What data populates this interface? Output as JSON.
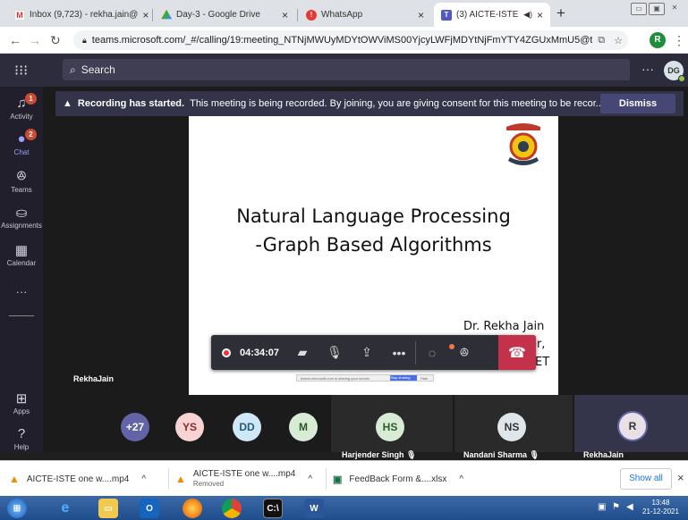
{
  "browser": {
    "tabs": [
      {
        "title": "Inbox (9,723) - rekha.jain@",
        "close": "×"
      },
      {
        "title": "Day-3 - Google Drive",
        "close": "×"
      },
      {
        "title": "WhatsApp",
        "close": "×"
      },
      {
        "title": "(3) AICTE-ISTE one wee",
        "close": "×"
      }
    ],
    "new_tab": "+",
    "url": "teams.microsoft.com/_#/calling/19:meeting_NTNjMWUyMDYtOWViMS00YjcyLWFjMDYtNjFmYTY4ZGUxMmU5@threa...",
    "profile_initial": "R"
  },
  "teams": {
    "search_placeholder": "Search",
    "user_initials": "DG",
    "more": "···",
    "rail": [
      {
        "label": "Activity",
        "badge": "1"
      },
      {
        "label": "Chat",
        "badge": "2"
      },
      {
        "label": "Teams"
      },
      {
        "label": "Assignments"
      },
      {
        "label": "Calendar"
      },
      {
        "label": "···"
      },
      {
        "label": "Apps"
      },
      {
        "label": "Help"
      }
    ]
  },
  "banner": {
    "bold": "Recording has started.",
    "text": "This meeting is being recorded. By joining, you are giving consent for this meeting to be recor...",
    "dismiss": "Dismiss"
  },
  "slide": {
    "title_line1": "Natural Language Processing",
    "title_line2": "-Graph Based Algorithms",
    "author": "Dr. Rekha Jain",
    "author_line2_partial": "or,",
    "author_line3_partial": "ET",
    "share_text": "teams.microsoft.com is sharing your screen",
    "share_stop": "Stop sharing",
    "share_hide": "Hide"
  },
  "call": {
    "timer": "04:34:07",
    "presenter_label": "RekhaJain"
  },
  "participants": {
    "overflow": "+27",
    "small": [
      {
        "initials": "YS",
        "bg": "#f7d3d3",
        "fg": "#8c2a2a"
      },
      {
        "initials": "DD",
        "bg": "#cfe8f7",
        "fg": "#245a7a"
      },
      {
        "initials": "M",
        "bg": "#d7ebd5",
        "fg": "#2b5b28"
      }
    ],
    "tiles": [
      {
        "initials": "HS",
        "name": "Harjender Singh"
      },
      {
        "initials": "NS",
        "name": "Nandani Sharma"
      },
      {
        "initials": "R",
        "name": "RekhaJain"
      }
    ]
  },
  "downloads": {
    "items": [
      {
        "name": "AICTE-ISTE one w....mp4",
        "sub": ""
      },
      {
        "name": "AICTE-ISTE one w....mp4",
        "sub": "Removed"
      },
      {
        "name": "FeedBack Form &....xlsx",
        "sub": ""
      }
    ],
    "show_all": "Show all",
    "close": "×"
  },
  "taskbar": {
    "time": "13:48",
    "date": "21-12-2021"
  }
}
